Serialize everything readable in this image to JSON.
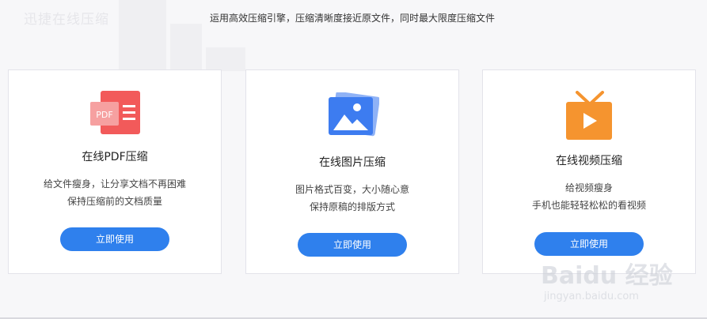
{
  "brand": "迅捷在线压缩",
  "tagline": "运用高效压缩引擎，压缩清晰度接近原文件，同时最大限度压缩文件",
  "cards": [
    {
      "icon": "pdf-icon",
      "icon_text": "PDF",
      "title": "在线PDF压缩",
      "desc1": "给文件瘦身，让分享文档不再困难",
      "desc2": "保持压缩前的文档质量",
      "button": "立即使用"
    },
    {
      "icon": "image-icon",
      "title": "在线图片压缩",
      "desc1": "图片格式百变，大小随心意",
      "desc2": "保持原稿的排版方式",
      "button": "立即使用"
    },
    {
      "icon": "tv-play-icon",
      "title": "在线视频压缩",
      "desc1": "给视频瘦身",
      "desc2": "手机也能轻轻松松的看视频",
      "button": "立即使用"
    }
  ],
  "watermark": {
    "line1": "Baidu 经验",
    "line2": "jingyan.baidu.com"
  },
  "colors": {
    "button": "#2f80ed",
    "pdf_icon": "#f25a5a",
    "image_icon": "#3d7cf0",
    "video_icon": "#f5942f"
  }
}
